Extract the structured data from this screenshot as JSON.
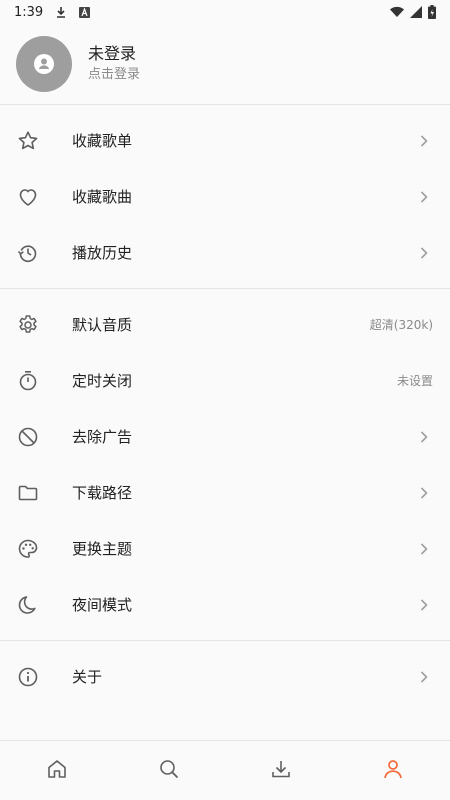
{
  "status_bar": {
    "time": "1:39",
    "icons": [
      "download-icon",
      "app-a-icon",
      "wifi-icon",
      "signal-icon",
      "battery-icon"
    ]
  },
  "profile": {
    "name": "未登录",
    "subtitle": "点击登录",
    "avatar_icon": "person-icon"
  },
  "menu_sections": [
    [
      {
        "icon": "star-icon",
        "label": "收藏歌单",
        "value": ""
      },
      {
        "icon": "heart-icon",
        "label": "收藏歌曲",
        "value": ""
      },
      {
        "icon": "history-icon",
        "label": "播放历史",
        "value": ""
      }
    ],
    [
      {
        "icon": "gear-icon",
        "label": "默认音质",
        "value": "超清(320k)"
      },
      {
        "icon": "timer-icon",
        "label": "定时关闭",
        "value": "未设置"
      },
      {
        "icon": "block-icon",
        "label": "去除广告",
        "value": ""
      },
      {
        "icon": "folder-icon",
        "label": "下载路径",
        "value": ""
      },
      {
        "icon": "palette-icon",
        "label": "更换主题",
        "value": ""
      },
      {
        "icon": "moon-icon",
        "label": "夜间模式",
        "value": ""
      }
    ],
    [
      {
        "icon": "info-icon",
        "label": "关于",
        "value": ""
      }
    ]
  ],
  "bottom_nav": {
    "items": [
      "home-icon",
      "search-icon",
      "download-icon",
      "profile-icon"
    ],
    "active_index": 3
  },
  "colors": {
    "accent": "#f4693a",
    "icon": "#5f5f5f",
    "chevron": "#9e9e9e",
    "background": "#fafafa"
  }
}
